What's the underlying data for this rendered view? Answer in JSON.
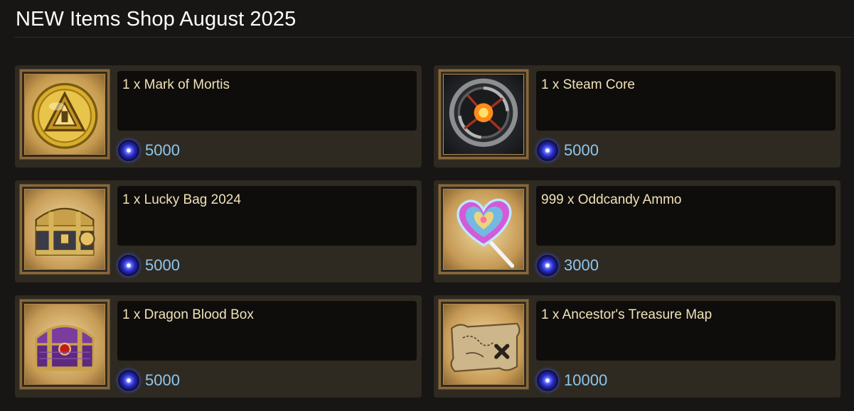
{
  "page": {
    "title": "NEW Items Shop August 2025"
  },
  "currency_icon": "blue-orb-gem-icon",
  "colors": {
    "background": "#171614",
    "card": "#2e2a21",
    "name_box": "#0e0d0b",
    "item_name": "#f1e1b8",
    "price": "#8ec6ee",
    "frame_gold": "#86683c"
  },
  "items": [
    {
      "name": "1 x Mark of Mortis",
      "price": "5000",
      "icon": "gold-coin-icon"
    },
    {
      "name": "1 x Steam Core",
      "price": "5000",
      "icon": "steam-core-icon"
    },
    {
      "name": "1 x Lucky Bag 2024",
      "price": "5000",
      "icon": "golden-chest-icon"
    },
    {
      "name": "999 x Oddcandy Ammo",
      "price": "3000",
      "icon": "heart-lollipop-icon"
    },
    {
      "name": "1 x Dragon Blood Box",
      "price": "5000",
      "icon": "purple-chest-icon"
    },
    {
      "name": "1 x Ancestor's Treasure Map",
      "price": "10000",
      "icon": "treasure-map-icon"
    }
  ]
}
